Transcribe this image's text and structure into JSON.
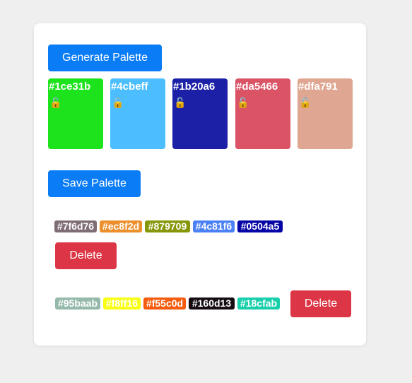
{
  "controls": {
    "generate_label": "Generate Palette",
    "save_label": "Save Palette"
  },
  "palette": [
    {
      "hex": "#1ce31b",
      "color": "#1ce31b",
      "lock_icon": "unlocked-padlock-icon"
    },
    {
      "hex": "#4cbeff",
      "color": "#4cbeff",
      "lock_icon": "unlocked-padlock-icon"
    },
    {
      "hex": "#1b20a6",
      "color": "#1b20a6",
      "lock_icon": "unlocked-padlock-icon"
    },
    {
      "hex": "#da5466",
      "color": "#da5466",
      "lock_icon": "unlocked-padlock-icon"
    },
    {
      "hex": "#dfa791",
      "color": "#dfa791",
      "lock_icon": "unlocked-padlock-icon"
    }
  ],
  "saved_palettes": [
    {
      "colors": [
        "#7f6d76",
        "#ec8f2d",
        "#879709",
        "#4c81f6",
        "#0504a5"
      ],
      "delete_label": "Delete"
    },
    {
      "colors": [
        "#95baab",
        "#f8ff16",
        "#f55c0d",
        "#160d13",
        "#18cfab"
      ],
      "delete_label": "Delete"
    }
  ]
}
